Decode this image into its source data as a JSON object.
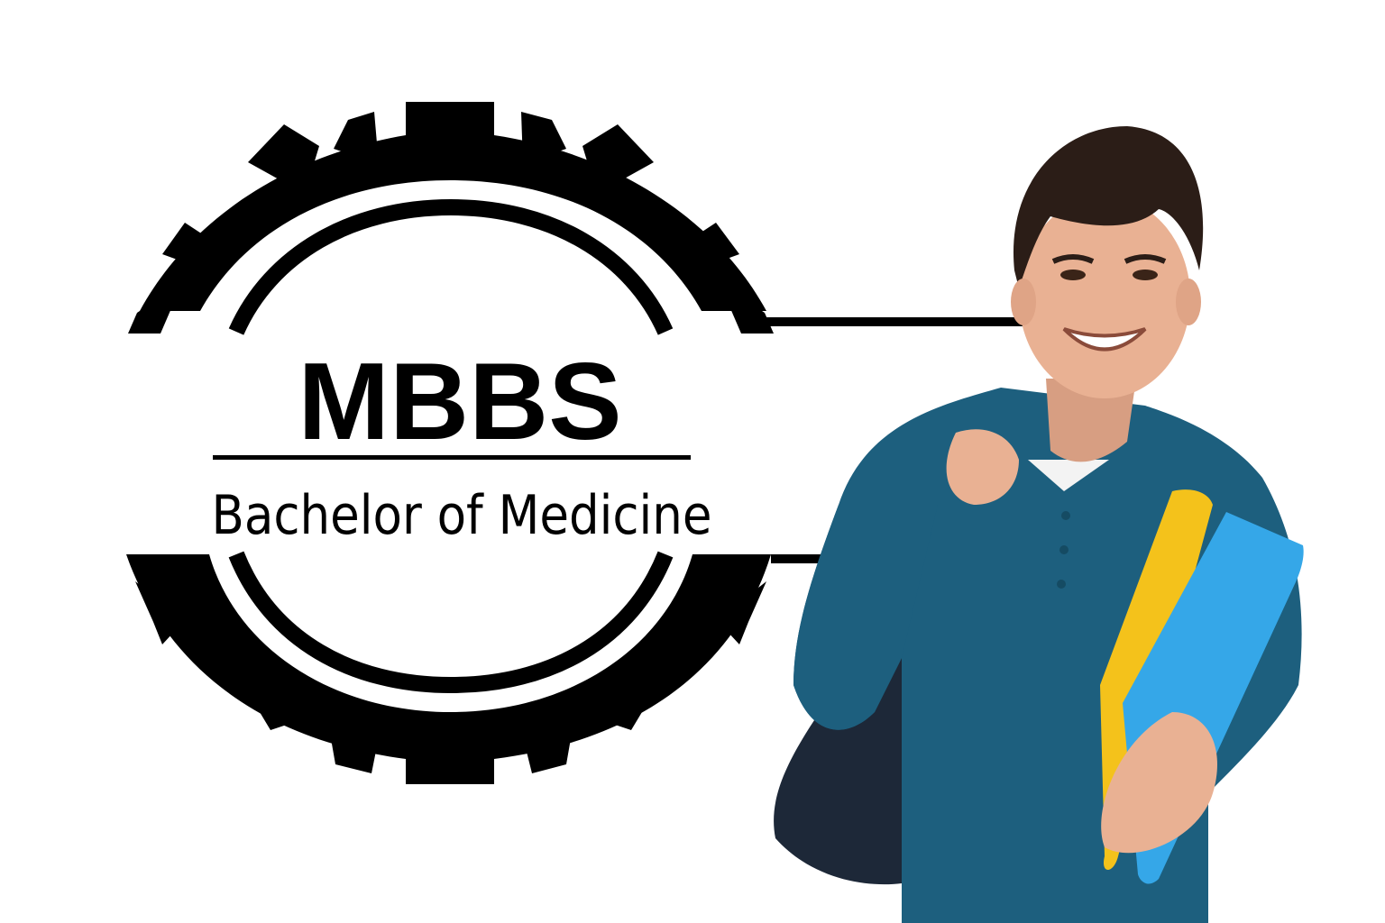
{
  "logo": {
    "title": "MBBS",
    "subtitle": "Bachelor of Medicine"
  },
  "colors": {
    "ink": "#000000",
    "background": "#ffffff",
    "shirt": "#1d5f7e",
    "folder_yellow": "#f4c21b",
    "folder_blue": "#35a7e8",
    "skin": "#e9b193",
    "hair": "#2b1d17",
    "backpack": "#1d2838"
  }
}
